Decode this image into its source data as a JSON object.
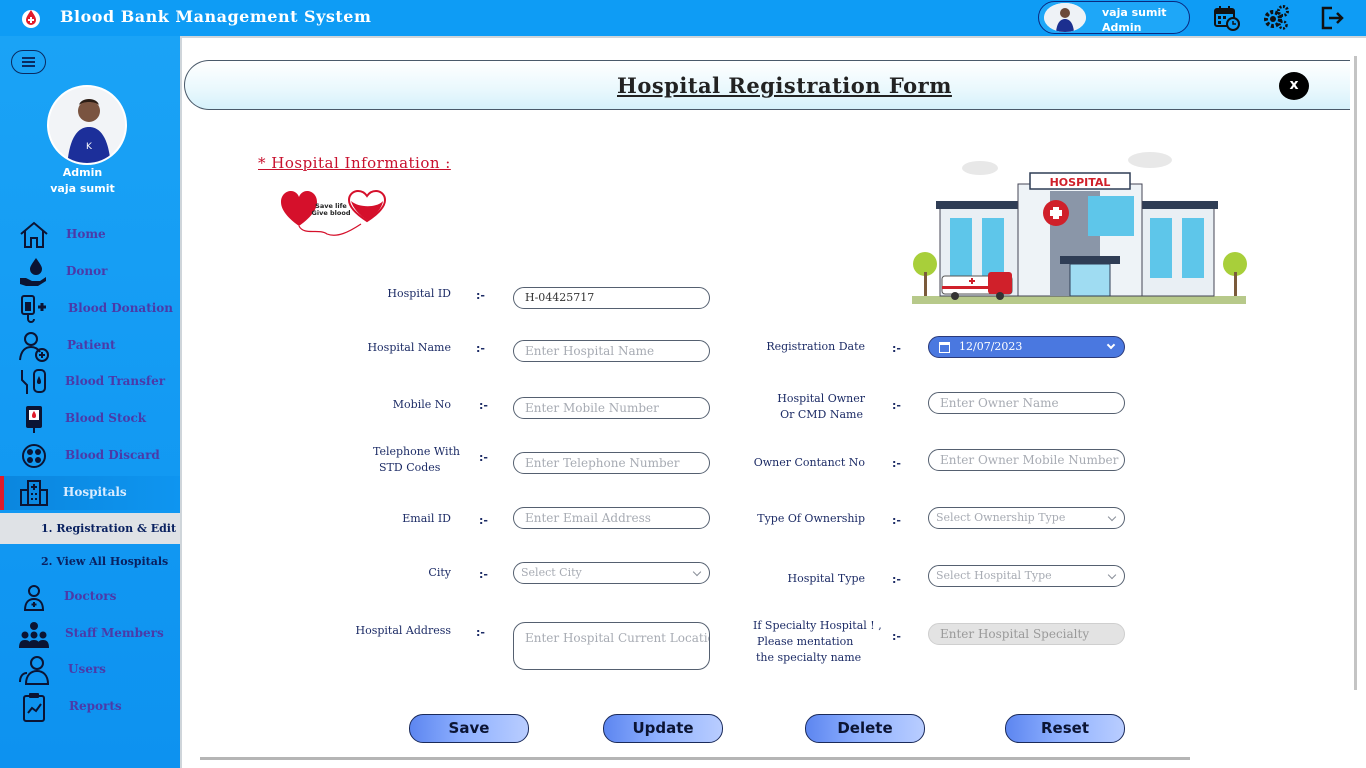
{
  "app": {
    "title": "Blood Bank Management System",
    "user_name": "vaja sumit",
    "user_role": "Admin"
  },
  "sidebar": {
    "profile_role": "Admin",
    "profile_name": "vaja sumit",
    "items": [
      {
        "label": "Home",
        "icon": "home-icon"
      },
      {
        "label": "Donor",
        "icon": "donor-icon"
      },
      {
        "label": "Blood Donation",
        "icon": "blood-donation-icon"
      },
      {
        "label": "Patient",
        "icon": "patient-icon"
      },
      {
        "label": "Blood Transfer",
        "icon": "blood-transfer-icon"
      },
      {
        "label": "Blood Stock",
        "icon": "blood-stock-icon"
      },
      {
        "label": "Blood Discard",
        "icon": "blood-discard-icon"
      },
      {
        "label": "Hospitals",
        "icon": "hospital-building-icon"
      },
      {
        "label": "Doctors",
        "icon": "doctor-icon"
      },
      {
        "label": "Staff Members",
        "icon": "staff-icon"
      },
      {
        "label": "Users",
        "icon": "users-icon"
      },
      {
        "label": "Reports",
        "icon": "reports-icon"
      }
    ],
    "subitems": [
      {
        "label": "1.  Registration & Edit"
      },
      {
        "label": "2.  View All Hospitals"
      }
    ]
  },
  "form": {
    "title": "Hospital Registration Form",
    "close_label": "x",
    "section_title": "* Hospital  Information  :",
    "hearts_text_1": "Save life",
    "hearts_text_2": "Give blood",
    "hospital_sign": "HOSPITAL",
    "colon": ":-",
    "labels": {
      "hospital_id": "Hospital  ID",
      "hospital_name": "Hospital Name",
      "mobile_no": "Mobile No",
      "telephone_1": "Telephone With",
      "telephone_2": "STD Codes",
      "email_id": "Email ID",
      "city": "City",
      "hospital_address": "Hospital Address",
      "registration_date": "Registration Date",
      "owner_1": "Hospital Owner",
      "owner_2": "Or CMD Name",
      "owner_contact": "Owner Contanct No",
      "ownership_type": "Type Of Ownership",
      "hospital_type": "Hospital Type",
      "specialty_1": "If Specialty Hospital ! ,",
      "specialty_2": "Please mentation",
      "specialty_3": "the specialty name"
    },
    "values": {
      "hospital_id": "H-04425717",
      "registration_date": "12/07/2023"
    },
    "placeholders": {
      "hospital_name": "Enter Hospital Name",
      "mobile_no": "Enter Mobile Number",
      "telephone": "Enter Telephone Number",
      "email": "Enter Email Address",
      "city": "Select City",
      "address": "Enter Hospital Current Location",
      "owner_name": "Enter Owner Name",
      "owner_mobile": "Enter Owner Mobile Number",
      "ownership_type": "Select Ownership Type",
      "hospital_type": "Select Hospital Type",
      "specialty": "Enter Hospital Specialty"
    },
    "buttons": {
      "save": "Save",
      "update": "Update",
      "delete": "Delete",
      "reset": "Reset"
    }
  },
  "colors": {
    "topbar": "#0e9cf5",
    "sidebar": "#1aa3f6",
    "active_marker": "#e01b2b",
    "section_title": "#c8102e",
    "date_field": "#4a78e0"
  }
}
